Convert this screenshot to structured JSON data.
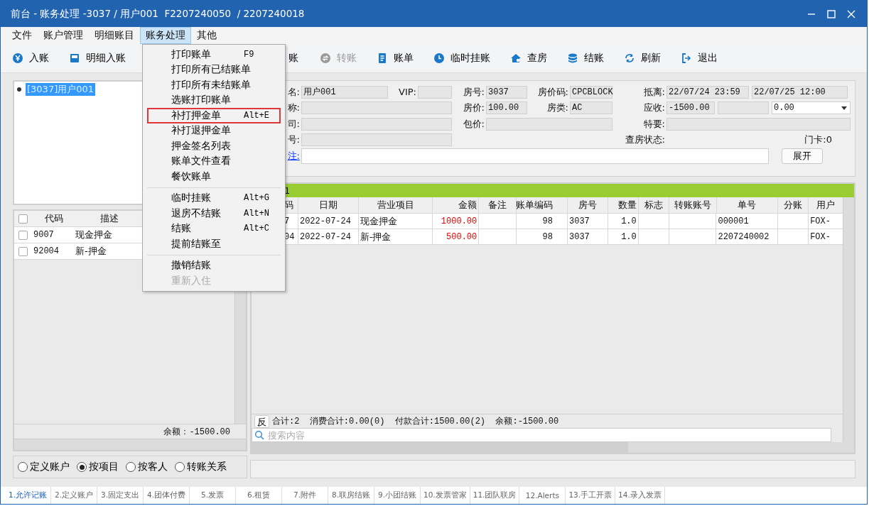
{
  "window": {
    "title": "前台 - 账务处理 -3037 / 用户001  F2207240050  / 2207240018"
  },
  "menu_bar": [
    {
      "label": "文件",
      "selected": false
    },
    {
      "label": "账户管理",
      "selected": false
    },
    {
      "label": "明细账目",
      "selected": false
    },
    {
      "label": "账务处理",
      "selected": true
    },
    {
      "label": "其他",
      "selected": false
    }
  ],
  "toolbar": [
    {
      "label": "入账",
      "disabled": false
    },
    {
      "label": "明细入账",
      "disabled": false
    },
    {
      "label": "账",
      "disabled": false
    },
    {
      "label": "转账",
      "disabled": true
    },
    {
      "label": "账单",
      "disabled": false
    },
    {
      "label": "临时挂账",
      "disabled": false
    },
    {
      "label": "查房",
      "disabled": false
    },
    {
      "label": "结账",
      "disabled": false
    },
    {
      "label": "刷新",
      "disabled": false
    },
    {
      "label": "退出",
      "disabled": false
    }
  ],
  "dropdown_menu": [
    {
      "kind": "item",
      "label": "打印账单",
      "shortcut": "F9",
      "selected": false,
      "disabled": false
    },
    {
      "kind": "item",
      "label": "打印所有已结账单",
      "selected": false,
      "disabled": false
    },
    {
      "kind": "item",
      "label": "打印所有未结账单",
      "selected": false,
      "disabled": false
    },
    {
      "kind": "item",
      "label": "选账打印账单",
      "selected": false,
      "disabled": false
    },
    {
      "kind": "item",
      "label": "补打押金单",
      "shortcut": "Alt+E",
      "selected": true,
      "disabled": false
    },
    {
      "kind": "item",
      "label": "补打退押金单",
      "selected": false,
      "disabled": false
    },
    {
      "kind": "item",
      "label": "押金签名列表",
      "selected": false,
      "disabled": false
    },
    {
      "kind": "item",
      "label": "账单文件查看",
      "selected": false,
      "disabled": false
    },
    {
      "kind": "item",
      "label": "餐饮账单",
      "selected": false,
      "disabled": false
    },
    {
      "kind": "separator"
    },
    {
      "kind": "item",
      "label": "临时挂账",
      "shortcut": "Alt+G",
      "selected": false,
      "disabled": false
    },
    {
      "kind": "item",
      "label": "退房不结账",
      "shortcut": "Alt+N",
      "selected": false,
      "disabled": false
    },
    {
      "kind": "item",
      "label": "结账",
      "shortcut": "Alt+C",
      "selected": false,
      "disabled": false
    },
    {
      "kind": "item",
      "label": "提前结账至",
      "selected": false,
      "disabled": false
    },
    {
      "kind": "separator"
    },
    {
      "kind": "item",
      "label": "撤销结账",
      "selected": false,
      "disabled": false
    },
    {
      "kind": "item",
      "label": "重新入住",
      "selected": false,
      "disabled": true
    }
  ],
  "account_tree": [
    {
      "label": "[3037]用户001",
      "selected": true
    }
  ],
  "item_list": {
    "header_checked": false,
    "columns": [
      "代码",
      "描述"
    ],
    "rows": [
      {
        "checked": false,
        "cells": [
          "9007",
          "现金押金"
        ]
      },
      {
        "checked": false,
        "cells": [
          "92004",
          "新-押金"
        ]
      }
    ],
    "balance": "余额：-1500.00"
  },
  "grouping": [
    {
      "label": "定义账户",
      "selected": false
    },
    {
      "label": "按项目",
      "selected": true
    },
    {
      "label": "按客人",
      "selected": false
    },
    {
      "label": "转账关系",
      "selected": false
    }
  ],
  "guest_info": {
    "name_label": "名:",
    "name": "用户001",
    "vip_label": "VIP:",
    "room_label": "房号:",
    "room": "3037",
    "rate_code_label": "房价码:",
    "rate_code": "CPCBLOCK",
    "stay_label": "抵离:",
    "arrival": "22/07/24 23:59",
    "departure": "22/07/25 12:00",
    "title_label": "称:",
    "rate_label": "房价:",
    "rate": "100.00",
    "room_type_label": "房类:",
    "room_type": "AC",
    "receivable_label": "应收:",
    "receivable": "-1500.00",
    "dropdown_value": "0.00",
    "company_label": "司:",
    "package_label": "包价:",
    "special_label": "特要:",
    "number_label": "号:",
    "inspection_label": "查房状态:",
    "key_card": "门卡:0",
    "remark_link": "注:",
    "expand_button": "展开"
  },
  "ledger": {
    "group_label": "1",
    "columns": [
      "码",
      "日期",
      "营业项目",
      "金额",
      "备注",
      "账单编码",
      "房号",
      "数量",
      "标志",
      "转账账号",
      "单号",
      "分账",
      "用户"
    ],
    "rows": [
      [
        "7",
        "2022-07-24",
        "现金押金",
        "1000.00",
        "",
        "98",
        "3037",
        "1.0",
        "",
        "",
        "000001",
        "",
        "FOX-"
      ],
      [
        "04",
        "2022-07-24",
        "新-押金",
        "500.00",
        "",
        "98",
        "3037",
        "1.0",
        "",
        "",
        "2207240002",
        "",
        "FOX-"
      ]
    ],
    "reverse_button": "反",
    "summary": "合计:2  消费合计:0.00(0)  付款合计:1500.00(2)  余额:-1500.00",
    "search_placeholder": "搜索内容"
  },
  "bottom_tabs": [
    {
      "label": "1.允许记账",
      "selected": true
    },
    {
      "label": "2.定义账户",
      "selected": false
    },
    {
      "label": "3.固定支出",
      "selected": false
    },
    {
      "label": "4.团体付费",
      "selected": false
    },
    {
      "label": "5.发票",
      "selected": false
    },
    {
      "label": "6.租赁",
      "selected": false
    },
    {
      "label": "7.附件",
      "selected": false
    },
    {
      "label": "8.联房结账",
      "selected": false
    },
    {
      "label": "9.小团结账",
      "selected": false
    },
    {
      "label": "10.发票管家",
      "selected": false
    },
    {
      "label": "11.团队联房",
      "selected": false
    },
    {
      "label": "12.Alerts",
      "selected": false
    },
    {
      "label": "13.手工开票",
      "selected": false
    },
    {
      "label": "14.录入发票",
      "selected": false
    }
  ]
}
